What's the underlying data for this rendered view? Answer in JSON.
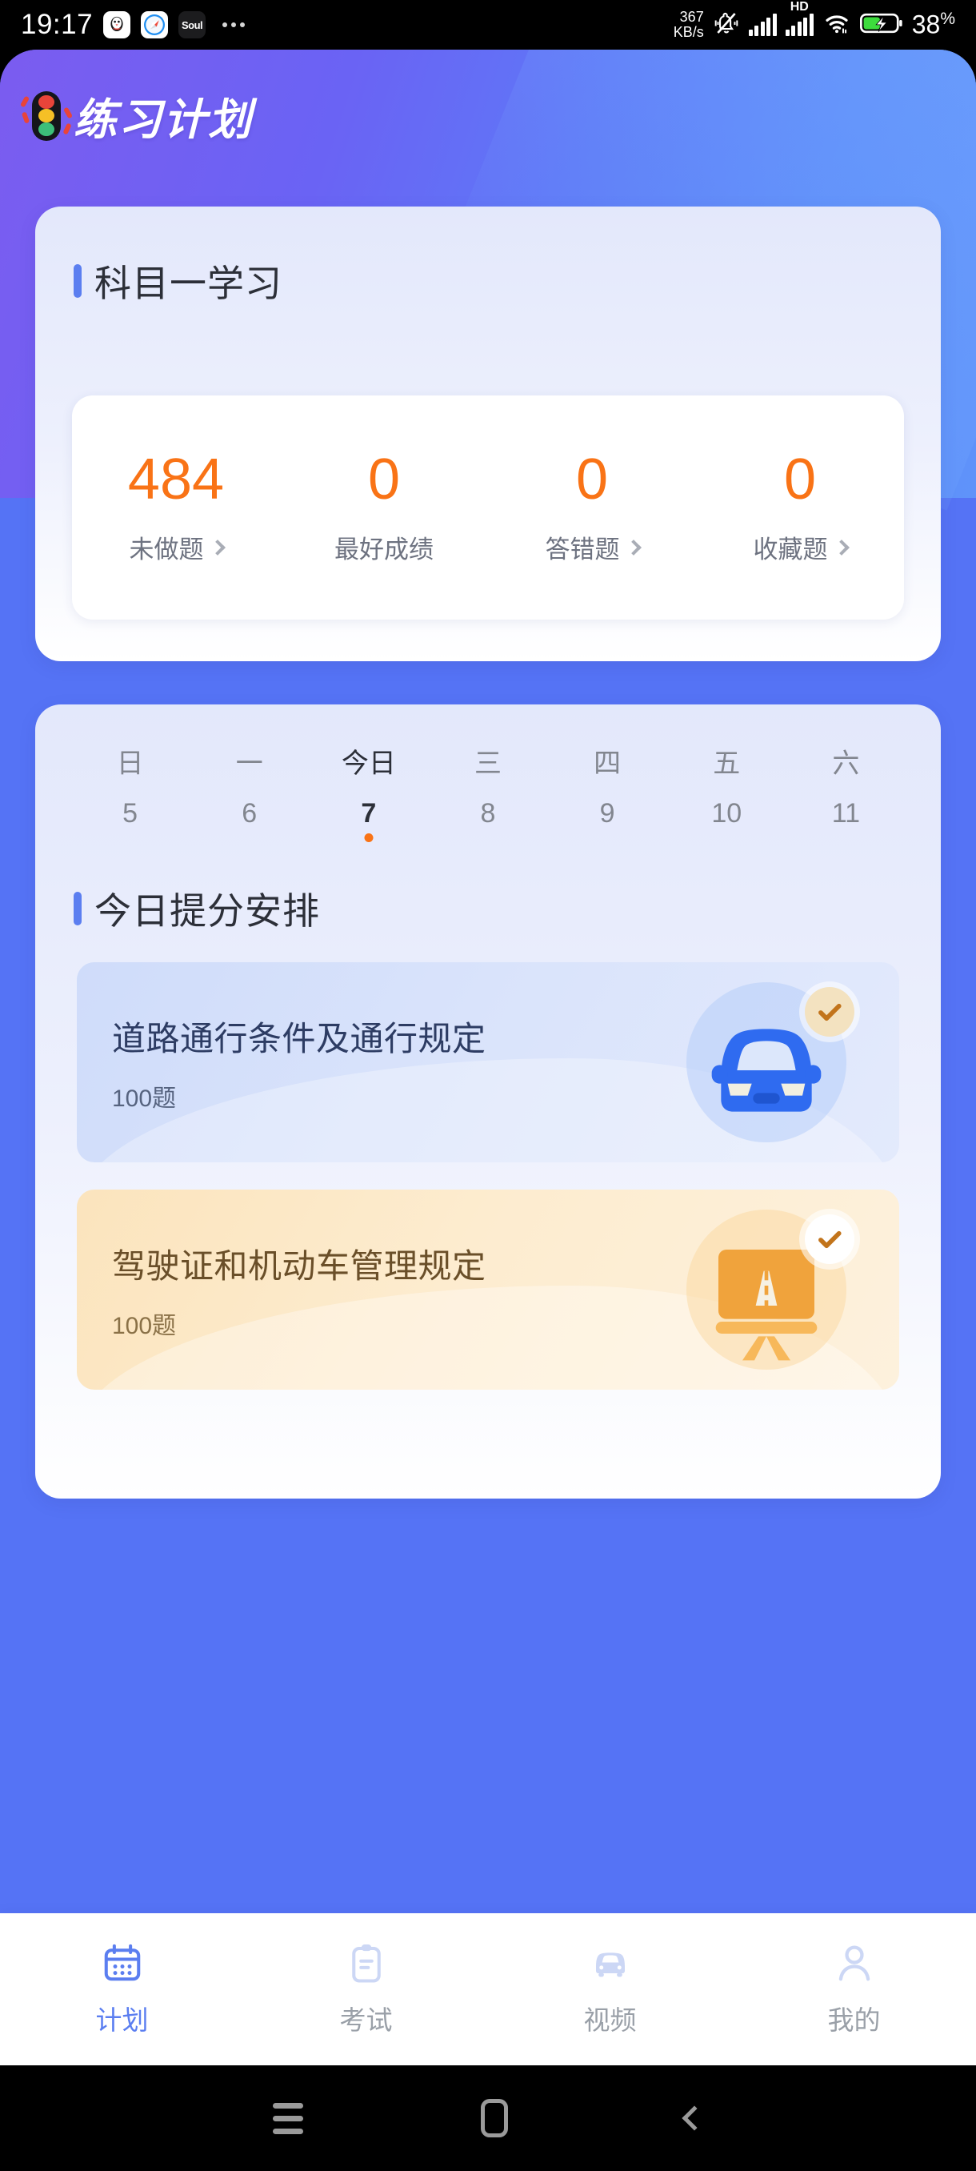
{
  "status_bar": {
    "time": "19:17",
    "app_icons": [
      "qq-icon",
      "safari-icon",
      "soul-icon"
    ],
    "soul_label": "Soul",
    "overflow": "more-apps-icon",
    "network_speed_value": "367",
    "network_speed_unit": "KB/s",
    "mute_icon": "bell-mute-icon",
    "signal_1": "signal-bars-icon",
    "hd_label": "HD",
    "signal_2": "signal-bars-icon",
    "wifi_icon": "wifi-icon",
    "battery_icon": "battery-charging-icon",
    "battery_percent": "38",
    "battery_percent_sign": "%"
  },
  "header": {
    "title": "练习计划",
    "logo": "traffic-light-icon"
  },
  "study_card": {
    "section_title": "科目一学习",
    "stats": [
      {
        "value": "484",
        "label": "未做题",
        "has_chevron": true
      },
      {
        "value": "0",
        "label": "最好成绩",
        "has_chevron": false
      },
      {
        "value": "0",
        "label": "答错题",
        "has_chevron": true
      },
      {
        "value": "0",
        "label": "收藏题",
        "has_chevron": true
      }
    ]
  },
  "plan_card": {
    "week": [
      {
        "day": "日",
        "date": "5",
        "today": false
      },
      {
        "day": "一",
        "date": "6",
        "today": false
      },
      {
        "day": "今日",
        "date": "7",
        "today": true
      },
      {
        "day": "三",
        "date": "8",
        "today": false
      },
      {
        "day": "四",
        "date": "9",
        "today": false
      },
      {
        "day": "五",
        "date": "10",
        "today": false
      },
      {
        "day": "六",
        "date": "11",
        "today": false
      }
    ],
    "section_title": "今日提分安排",
    "tasks": [
      {
        "name": "道路通行条件及通行规定",
        "count": "100题",
        "theme": "blue",
        "art": "car-icon",
        "badge": "check-badge-icon"
      },
      {
        "name": "驾驶证和机动车管理规定",
        "count": "100题",
        "theme": "amber",
        "art": "road-board-icon",
        "badge": "check-badge-icon"
      }
    ]
  },
  "tabbar": {
    "items": [
      {
        "label": "计划",
        "icon": "calendar-icon",
        "active": true
      },
      {
        "label": "考试",
        "icon": "clipboard-icon",
        "active": false
      },
      {
        "label": "视频",
        "icon": "car-icon",
        "active": false
      },
      {
        "label": "我的",
        "icon": "person-icon",
        "active": false
      }
    ]
  },
  "android_nav": {
    "recents": "recents-icon",
    "home": "home-icon",
    "back": "back-icon"
  },
  "colors": {
    "brand_blue": "#5573f5",
    "accent_orange": "#f97316",
    "section_bar": "#5b7ef0",
    "active_tab": "#5b7ef0"
  }
}
